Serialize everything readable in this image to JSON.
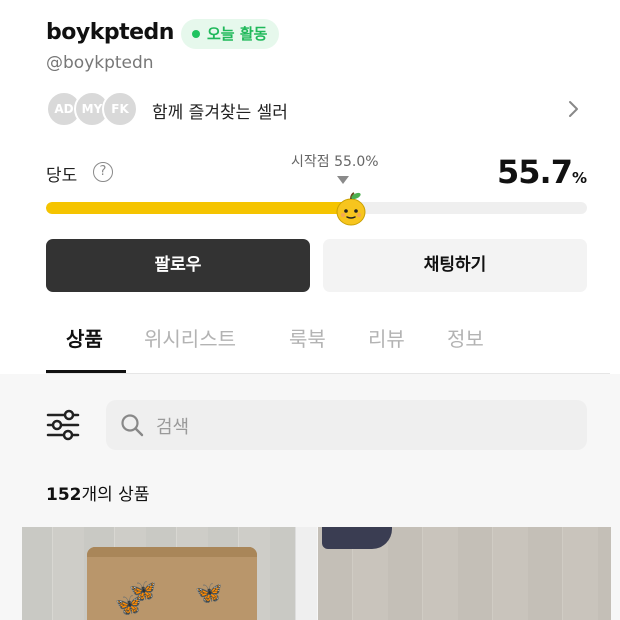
{
  "profile": {
    "name": "boykptedn",
    "status_badge": "오늘 활동",
    "handle": "@boykptedn"
  },
  "sellers": {
    "avatars": [
      "AD",
      "MY",
      "FK"
    ],
    "label": "함께 즐겨찾는 셀러"
  },
  "temperature": {
    "label": "당도",
    "help": "?",
    "start_label": "시작점 55.0%",
    "value": "55.7",
    "unit": "%",
    "fill_percent": 55.7
  },
  "actions": {
    "follow_label": "팔로우",
    "chat_label": "채팅하기"
  },
  "tabs": [
    {
      "label": "상품",
      "active": true
    },
    {
      "label": "위시리스트",
      "active": false
    },
    {
      "label": "룩북",
      "active": false
    },
    {
      "label": "리뷰",
      "active": false
    },
    {
      "label": "정보",
      "active": false
    }
  ],
  "search": {
    "placeholder": "검색"
  },
  "products": {
    "count": "152",
    "count_suffix": "개의 상품"
  },
  "colors": {
    "accent_green": "#1fc35f",
    "progress_yellow": "#f5c400",
    "follow_button": "#333333"
  },
  "icons": {
    "help": "question-circle-icon",
    "chevron": "chevron-right-icon",
    "filter": "filter-sliders-icon",
    "search": "search-icon",
    "mascot": "apple-mascot-icon"
  }
}
